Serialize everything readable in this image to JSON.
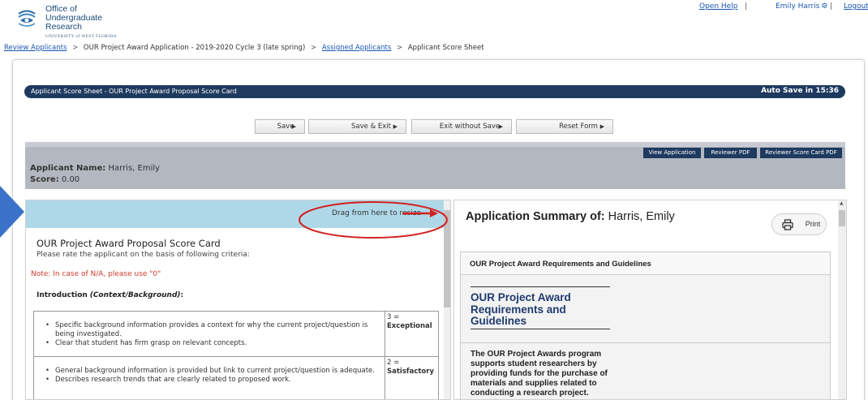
{
  "logo": {
    "line1": "Office of",
    "line2": "Undergraduate Research",
    "line3": "UNIVERSITY of WEST FLORIDA"
  },
  "top_links": {
    "help": "Open Help",
    "separator": "|",
    "user": "Emily Harris",
    "logout": "Logout"
  },
  "breadcrumb": {
    "items": [
      "Review Applicants",
      "OUR Project Award Application - 2019-2020 Cycle 3 (late spring)",
      "Assigned Applicants",
      "Applicant Score Sheet"
    ],
    "separator": ">"
  },
  "header": {
    "title": "Applicant Score Sheet - OUR Project Award Proposal Score Card",
    "autosave": "Auto Save in 15:36"
  },
  "actions": {
    "save": "Save",
    "save_exit": "Save & Exit",
    "exit_without_save": "Exit without Save",
    "reset": "Reset Form"
  },
  "view_buttons": {
    "view_application": "View Application",
    "reviewer_pdf": "Reviewer PDF",
    "reviewer_score_card_pdf": "Reviewer Score Card PDF"
  },
  "applicant": {
    "name_label": "Applicant Name:",
    "name": "Harris, Emily",
    "score_label": "Score:",
    "score": "0.00"
  },
  "left_pane": {
    "resize_hint": "Drag from here to resize",
    "close": "×",
    "card_title": "OUR Project Award Proposal Score Card",
    "card_subtitle": "Please rate the applicant on the basis of following criteria:",
    "note": "Note: In case of N/A, please use \"0\"",
    "section_label": "Introduction",
    "section_sub": "(Context/Background)",
    "section_colon": ":",
    "criteria": [
      {
        "bullets": [
          "Specific background information provides a context for why the current project/question is being investigated.",
          "Clear that student has firm grasp on relevant concepts."
        ],
        "score_value": "3 =",
        "score_label": "Exceptional"
      },
      {
        "bullets": [
          "General background information is provided but link to current project/question is adequate.",
          "Describes research trends that are clearly related to proposed work."
        ],
        "score_value": "2 =",
        "score_label": "Satisfactory"
      }
    ]
  },
  "right_pane": {
    "summary_prefix": "Application Summary of:",
    "summary_name": "Harris, Emily",
    "print": "Print",
    "requirements_heading": "OUR Project Award Requirements and Guidelines",
    "requirements_title": "OUR Project Award Requirements and Guidelines",
    "requirements_body": "The OUR Project Awards program supports student researchers by providing funds for the purchase of materials and supplies related to conducting a research project."
  },
  "colors": {
    "navy": "#1e3a5f",
    "link": "#1a55b0",
    "note_red": "#d23b2b",
    "highlight_blue": "#aed8e8",
    "band_gray": "#b3b8c0",
    "callout_red": "#d42020",
    "side_arrow_blue": "#3a72c9"
  },
  "icons": {
    "gear": "gear-icon",
    "arrow": "triangle-right-icon",
    "print": "printer-icon",
    "resize_arrow": "red-arrow-right-icon",
    "side_arrow": "blue-arrow-right-icon"
  }
}
